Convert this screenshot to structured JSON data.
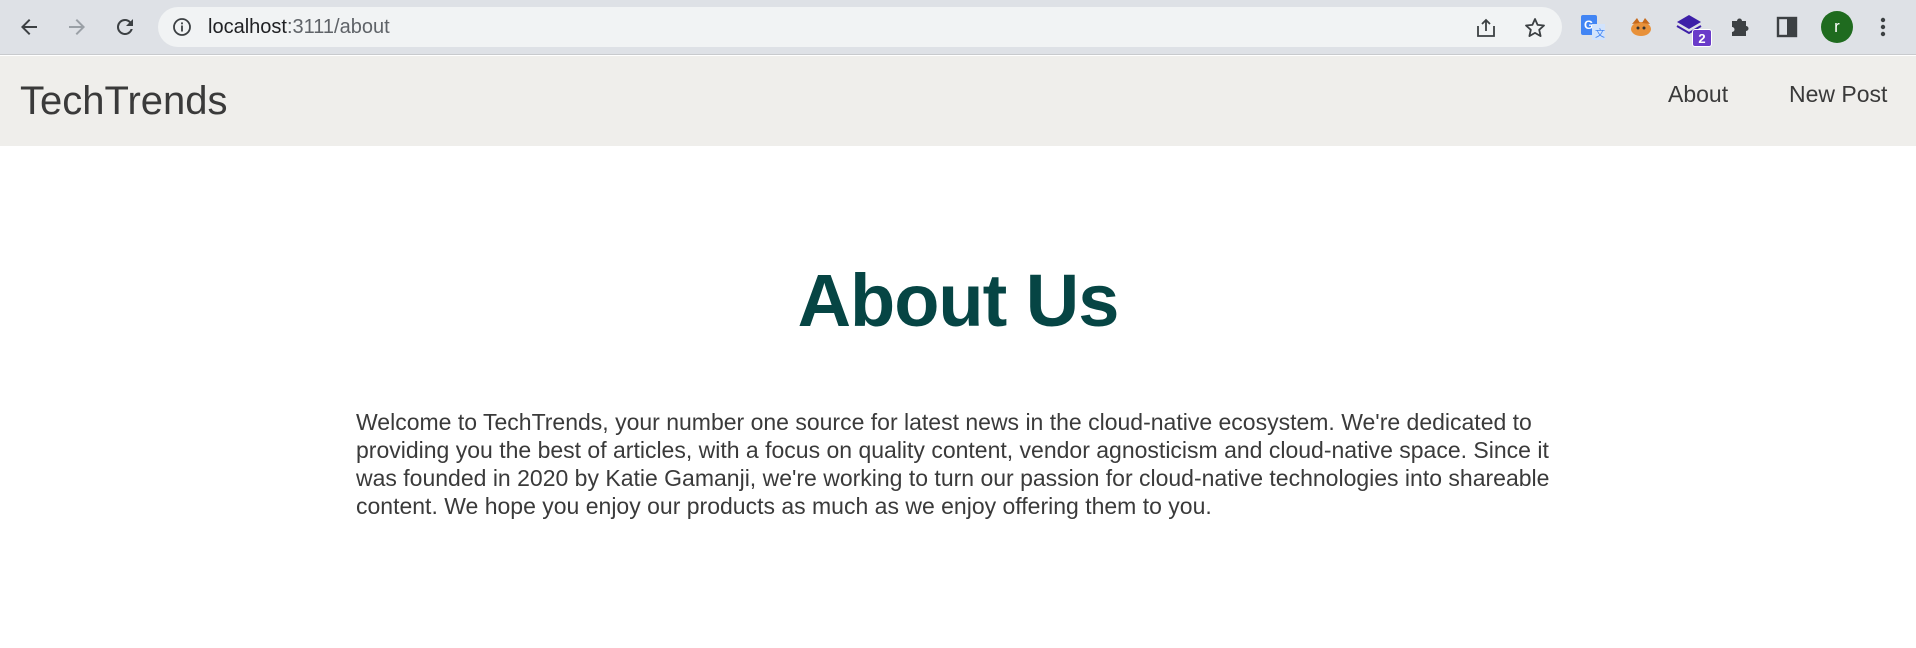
{
  "browser": {
    "url_host": "localhost",
    "url_path": ":3111/about",
    "avatar_letter": "r",
    "extension_badge": "2",
    "icons": [
      "back-icon",
      "forward-icon",
      "reload-icon",
      "info-icon",
      "share-icon",
      "star-icon",
      "translate-icon",
      "fox-extension-icon",
      "stack-extension-icon",
      "puzzle-icon",
      "side-panel-icon",
      "kebab-menu-icon"
    ]
  },
  "navbar": {
    "brand": "TechTrends",
    "links": [
      "About",
      "New Post"
    ]
  },
  "main": {
    "title": "About Us",
    "body": "Welcome to TechTrends, your number one source for latest news in the cloud-native ecosystem. We're dedicated to providing you the best of articles, with a focus on quality content, vendor agnosticism and cloud-native space. Since it was founded in 2020 by Katie Gamanji, we're working to turn our passion for cloud-native technologies into shareable content. We hope you enjoy our products as much as we enjoy offering them to you."
  },
  "colors": {
    "title": "#064544",
    "navbar_bg": "#efeeeb",
    "chrome_bg": "#dee1e6",
    "text": "#3a3a3a"
  }
}
